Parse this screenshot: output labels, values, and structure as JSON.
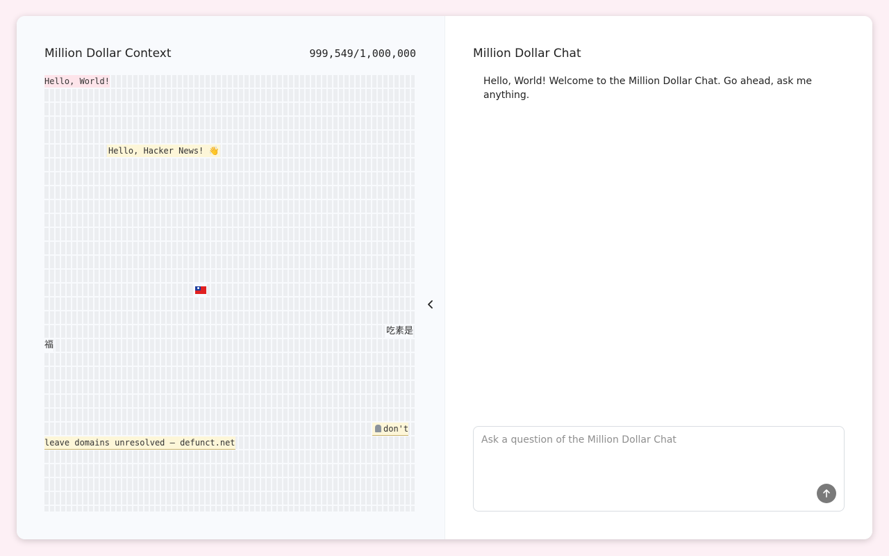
{
  "context_panel": {
    "title": "Million Dollar Context",
    "counter": "999,549/1,000,000",
    "entries": {
      "hello_world": "Hello, World!",
      "hello_hn": "Hello, Hacker News! 👋",
      "taiwan_flag": "flag-taiwan-icon",
      "vegan_line1": "吃素是",
      "vegan_line2": "福",
      "defunct_line1": "don't",
      "defunct_line2": " leave domains unresolved — defunct.net"
    }
  },
  "nav": {
    "prev": "chevron-left-icon",
    "next": "chevron-right-icon"
  },
  "chat_panel": {
    "title": "Million Dollar Chat",
    "welcome": "Hello, World! Welcome to the Million Dollar Chat. Go ahead, ask me anything.",
    "input_placeholder": "Ask a question of the Million Dollar Chat",
    "send_icon": "arrow-up-icon"
  },
  "colors": {
    "page_bg": "#fdf0f5",
    "highlight_pink": "#fde4ea",
    "highlight_yellow": "#fdf6d8",
    "send_button": "#7a7a7a"
  }
}
